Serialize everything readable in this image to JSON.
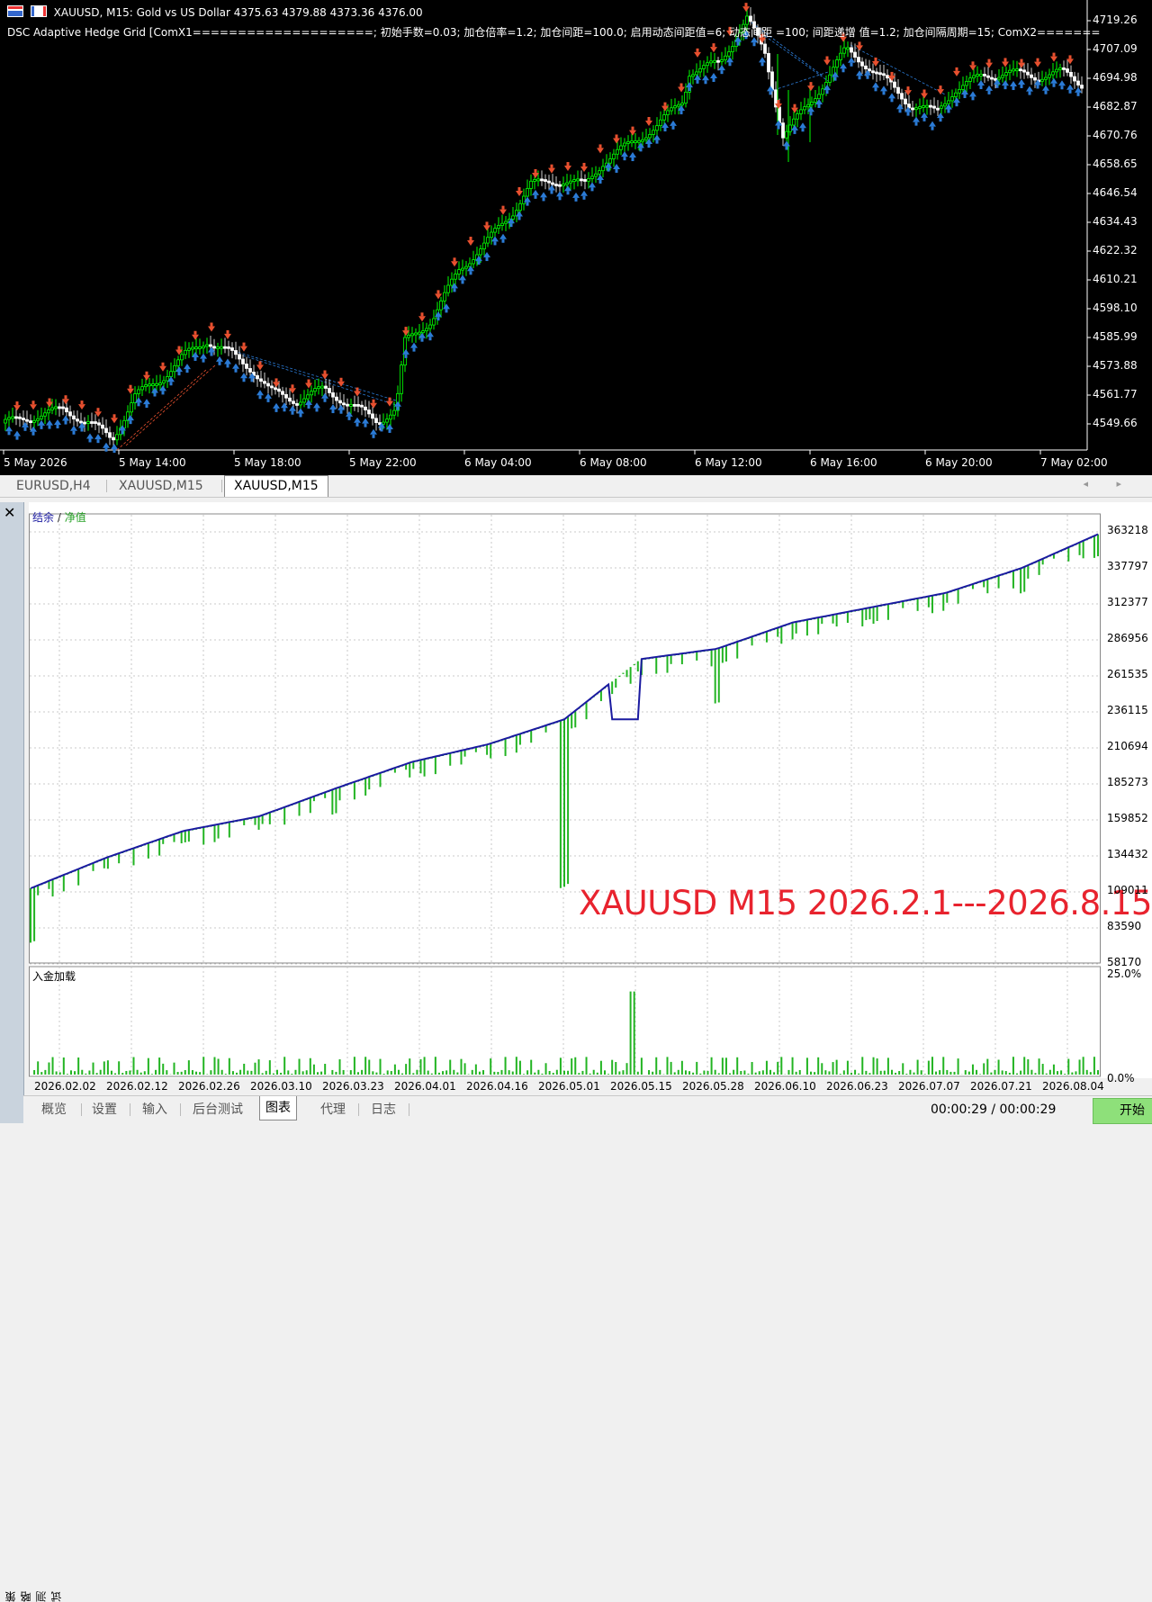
{
  "chart_window": {
    "symbol_line": "XAUUSD, M15:  Gold vs US Dollar  4375.63 4379.88 4373.36 4376.00",
    "params_line": "DSC Adaptive Hedge Grid [ComX1====================; 初始手数=0.03; 加仓倍率=1.2; 加仓间距=100.0; 启用动态间距值=6; 动态间距    =100; 间距递增     值=1.2; 加仓间隔周期=15; ComX2=======",
    "colors": {
      "background": "#000000",
      "bull": "#00ff00",
      "bear": "#ff4a28",
      "buy_arrow": "#2b7bd6",
      "sell_arrow": "#e8502f"
    },
    "price_ticks": [
      "4719.26",
      "4707.09",
      "4694.98",
      "4682.87",
      "4670.76",
      "4658.65",
      "4646.54",
      "4634.43",
      "4622.32",
      "4610.21",
      "4598.10",
      "4585.99",
      "4573.88",
      "4561.77",
      "4549.66"
    ],
    "time_ticks": [
      "5 May 2026",
      "5 May 14:00",
      "5 May 18:00",
      "5 May 22:00",
      "6 May 04:00",
      "6 May 08:00",
      "6 May 12:00",
      "6 May 16:00",
      "6 May 20:00",
      "7 May 02:00"
    ]
  },
  "chart_tabs": {
    "items": [
      "EURUSD,H4",
      "XAUUSD,M15",
      "XAUUSD,M15"
    ],
    "active_index": 2,
    "scroll_arrows": "◂ ▸"
  },
  "tester": {
    "close_icon": "✕",
    "side_label": "策略测试",
    "legend_balance": "结余",
    "legend_sep": " / ",
    "legend_equity": "净值",
    "overlay_text": "XAUUSD M15 2026.2.1---2026.8.15",
    "load_label": "入金加载",
    "load_ticks": [
      "25.0%",
      "0.0%"
    ],
    "colors": {
      "balance": "#1a1aa0",
      "equity": "#22b422",
      "overlay": "#e8232e"
    }
  },
  "chart_data": {
    "type": "line",
    "title": "",
    "x": [
      "2026.02.02",
      "2026.02.12",
      "2026.02.26",
      "2026.03.10",
      "2026.03.23",
      "2026.04.01",
      "2026.04.16",
      "2026.05.01",
      "2026.05.15",
      "2026.05.28",
      "2026.06.10",
      "2026.06.23",
      "2026.07.07",
      "2026.07.21",
      "2026.08.04"
    ],
    "y_ticks": [
      "363218",
      "337797",
      "312377",
      "286956",
      "261535",
      "236115",
      "210694",
      "185273",
      "159852",
      "134432",
      "109011",
      "83590",
      "58170"
    ],
    "ylim": [
      58170,
      363218
    ],
    "series": [
      {
        "name": "结余",
        "values": [
          109000,
          130000,
          148000,
          158000,
          177000,
          195000,
          207000,
          224000,
          265000,
          272000,
          290000,
          300000,
          310000,
          327000,
          350000
        ]
      },
      {
        "name": "净值",
        "values": [
          72000,
          125000,
          140000,
          152000,
          160000,
          190000,
          200000,
          110000,
          258000,
          235000,
          282000,
          292000,
          303000,
          310000,
          335000
        ]
      }
    ],
    "load_series": {
      "name": "入金加载",
      "ylim_percent": [
        0,
        25
      ],
      "peak_percent": 21
    }
  },
  "bottom_tabs": {
    "items": [
      "概览",
      "设置",
      "输入",
      "后台测试",
      "图表",
      "代理",
      "日志"
    ],
    "active_index": 4,
    "timer": "00:00:29 / 00:00:29",
    "start_label": "开始"
  }
}
